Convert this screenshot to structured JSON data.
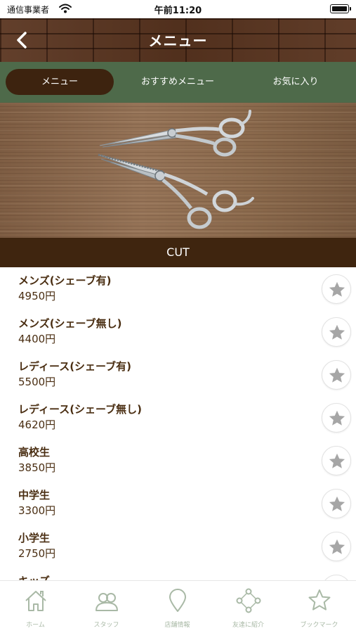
{
  "status_bar": {
    "carrier": "通信事業者",
    "time": "午前11:20"
  },
  "header": {
    "title": "メニュー",
    "back_icon": "chevron-left-icon"
  },
  "tabs": [
    {
      "label": "メニュー",
      "active": true
    },
    {
      "label": "おすすめメニュー",
      "active": false
    },
    {
      "label": "お気に入り",
      "active": false
    }
  ],
  "hero": {
    "image": "scissors-on-wood-photo"
  },
  "section": {
    "title": "CUT"
  },
  "menu_items": [
    {
      "name": "メンズ(シェーブ有)",
      "price": "4950円"
    },
    {
      "name": "メンズ(シェーブ無し)",
      "price": "4400円"
    },
    {
      "name": "レディース(シェーブ有)",
      "price": "5500円"
    },
    {
      "name": "レディース(シェーブ無し)",
      "price": "4620円"
    },
    {
      "name": "高校生",
      "price": "3850円"
    },
    {
      "name": "中学生",
      "price": "3300円"
    },
    {
      "name": "小学生",
      "price": "2750円"
    },
    {
      "name": "キッズ",
      "price": ""
    }
  ],
  "favorite_icon": "star-icon",
  "tab_bar": [
    {
      "label": "ホーム",
      "icon": "home-icon"
    },
    {
      "label": "スタッフ",
      "icon": "staff-icon"
    },
    {
      "label": "店舗情報",
      "icon": "location-pin-icon"
    },
    {
      "label": "友達に紹介",
      "icon": "share-icon"
    },
    {
      "label": "ブックマーク",
      "icon": "star-outline-icon"
    }
  ],
  "colors": {
    "accent_brown": "#3f250f",
    "tab_green": "#4e6a4a",
    "text_brown": "#4a2e12",
    "star_gray": "#a6a6a6",
    "tab_bar_green": "#a9b9a6"
  }
}
